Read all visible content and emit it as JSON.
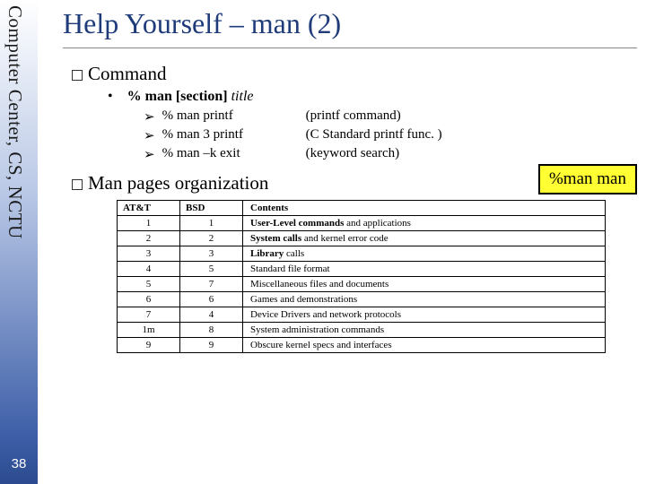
{
  "sidebar": {
    "org": "Computer Center, CS, NCTU",
    "page": "38"
  },
  "title": "Help Yourself – man (2)",
  "sections": {
    "command": {
      "heading": "Command",
      "usage_prefix": "% man",
      "usage_bracket": "[section]",
      "usage_italic": "title",
      "examples": [
        {
          "cmd": "% man printf",
          "desc": "(printf command)"
        },
        {
          "cmd": "% man 3 printf",
          "desc": "(C Standard printf func. )"
        },
        {
          "cmd": "% man –k exit",
          "desc": "(keyword search)"
        }
      ]
    },
    "callout": "%man man",
    "org_heading": "Man pages organization",
    "table": {
      "headers": {
        "c1": "AT&T",
        "c2": "BSD",
        "c3": "Contents"
      },
      "rows": [
        {
          "att": "1",
          "bsd": "1",
          "bold": "User-Level commands",
          "rest": " and applications"
        },
        {
          "att": "2",
          "bsd": "2",
          "bold": "System calls",
          "rest": " and kernel error code"
        },
        {
          "att": "3",
          "bsd": "3",
          "bold": "Library",
          "rest": " calls"
        },
        {
          "att": "4",
          "bsd": "5",
          "bold": "",
          "rest": "Standard file format"
        },
        {
          "att": "5",
          "bsd": "7",
          "bold": "",
          "rest": "Miscellaneous files and documents"
        },
        {
          "att": "6",
          "bsd": "6",
          "bold": "",
          "rest": "Games and demonstrations"
        },
        {
          "att": "7",
          "bsd": "4",
          "bold": "",
          "rest": "Device Drivers and network protocols"
        },
        {
          "att": "1m",
          "bsd": "8",
          "bold": "",
          "rest": "System administration commands"
        },
        {
          "att": "9",
          "bsd": "9",
          "bold": "",
          "rest": "Obscure kernel specs and interfaces"
        }
      ]
    }
  }
}
